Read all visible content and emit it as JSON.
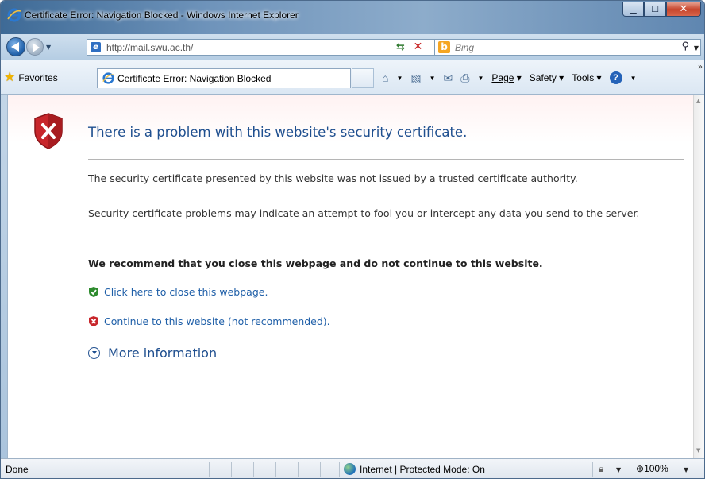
{
  "window": {
    "title": "Certificate Error: Navigation Blocked - Windows Internet Explorer",
    "caption_buttons": {
      "minimize": "▁",
      "maximize": "☐",
      "close": "✕"
    }
  },
  "navigation": {
    "address": "http://mail.swu.ac.th/",
    "search_placeholder": "Bing"
  },
  "command_bar": {
    "favorites_label": "Favorites",
    "tab_title": "Certificate Error: Navigation Blocked",
    "page_label": "Page",
    "safety_label": "Safety",
    "tools_label": "Tools"
  },
  "content": {
    "heading": "There is a problem with this website's security certificate.",
    "para1": "The security certificate presented by this website was not issued by a trusted certificate authority.",
    "para2": "Security certificate problems may indicate an attempt to fool you or intercept any data you send to the server.",
    "recommend": "We recommend that you close this webpage and do not continue to this website.",
    "link_close": "Click here to close this webpage.",
    "link_continue": "Continue to this website (not recommended).",
    "more_info": "More information"
  },
  "status_bar": {
    "status": "Done",
    "zone": "Internet | Protected Mode: On",
    "zoom": "100%"
  },
  "colors": {
    "heading": "#1f4f8f",
    "link": "#1f5fa8",
    "shield_red": "#c8262b",
    "shield_green": "#2e8b2e"
  },
  "icons": [
    "ie-logo-icon",
    "back-arrow-icon",
    "forward-arrow-icon",
    "page-icon",
    "refresh-icon",
    "stop-icon",
    "bing-logo-icon",
    "search-icon",
    "favorites-star-icon",
    "home-icon",
    "feeds-icon",
    "mail-icon",
    "print-icon",
    "help-icon",
    "error-shield-icon",
    "green-shield-icon",
    "red-shield-icon",
    "chevron-circle-down-icon",
    "globe-icon",
    "lock-icon",
    "zoom-icon"
  ]
}
